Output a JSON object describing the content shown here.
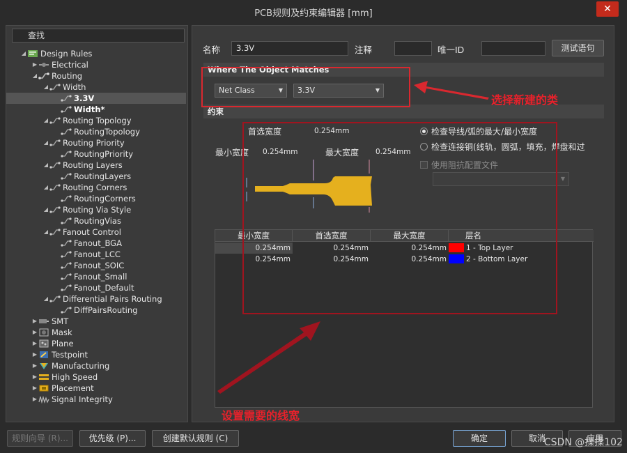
{
  "window": {
    "title": "PCB规则及约束编辑器 [mm]",
    "close_glyph": "✕"
  },
  "search": {
    "placeholder": "查找"
  },
  "tree": [
    {
      "label": "Design Rules",
      "depth": 0,
      "expanded": true,
      "icon": "rules-icon"
    },
    {
      "label": "Electrical",
      "depth": 1,
      "expanded": false,
      "icon": "electrical-icon"
    },
    {
      "label": "Routing",
      "depth": 1,
      "expanded": true,
      "icon": "routing-icon"
    },
    {
      "label": "Width",
      "depth": 2,
      "expanded": true,
      "icon": "rule-icon"
    },
    {
      "label": "3.3V",
      "depth": 3,
      "selected": true,
      "bold": true,
      "icon": "rule-icon"
    },
    {
      "label": "Width*",
      "depth": 3,
      "bold": true,
      "icon": "rule-icon"
    },
    {
      "label": "Routing Topology",
      "depth": 2,
      "expanded": true,
      "icon": "rule-icon"
    },
    {
      "label": "RoutingTopology",
      "depth": 3,
      "icon": "rule-icon"
    },
    {
      "label": "Routing Priority",
      "depth": 2,
      "expanded": true,
      "icon": "rule-icon"
    },
    {
      "label": "RoutingPriority",
      "depth": 3,
      "icon": "rule-icon"
    },
    {
      "label": "Routing Layers",
      "depth": 2,
      "expanded": true,
      "icon": "rule-icon"
    },
    {
      "label": "RoutingLayers",
      "depth": 3,
      "icon": "rule-icon"
    },
    {
      "label": "Routing Corners",
      "depth": 2,
      "expanded": true,
      "icon": "rule-icon"
    },
    {
      "label": "RoutingCorners",
      "depth": 3,
      "icon": "rule-icon"
    },
    {
      "label": "Routing Via Style",
      "depth": 2,
      "expanded": true,
      "icon": "rule-icon"
    },
    {
      "label": "RoutingVias",
      "depth": 3,
      "icon": "rule-icon"
    },
    {
      "label": "Fanout Control",
      "depth": 2,
      "expanded": true,
      "icon": "rule-icon"
    },
    {
      "label": "Fanout_BGA",
      "depth": 3,
      "icon": "rule-icon"
    },
    {
      "label": "Fanout_LCC",
      "depth": 3,
      "icon": "rule-icon"
    },
    {
      "label": "Fanout_SOIC",
      "depth": 3,
      "icon": "rule-icon"
    },
    {
      "label": "Fanout_Small",
      "depth": 3,
      "icon": "rule-icon"
    },
    {
      "label": "Fanout_Default",
      "depth": 3,
      "icon": "rule-icon"
    },
    {
      "label": "Differential Pairs Routing",
      "depth": 2,
      "expanded": true,
      "icon": "rule-icon"
    },
    {
      "label": "DiffPairsRouting",
      "depth": 3,
      "icon": "rule-icon"
    },
    {
      "label": "SMT",
      "depth": 1,
      "expanded": false,
      "icon": "smt-icon"
    },
    {
      "label": "Mask",
      "depth": 1,
      "expanded": false,
      "icon": "mask-icon"
    },
    {
      "label": "Plane",
      "depth": 1,
      "expanded": false,
      "icon": "plane-icon"
    },
    {
      "label": "Testpoint",
      "depth": 1,
      "expanded": false,
      "icon": "testpoint-icon"
    },
    {
      "label": "Manufacturing",
      "depth": 1,
      "expanded": false,
      "icon": "manufacturing-icon"
    },
    {
      "label": "High Speed",
      "depth": 1,
      "expanded": false,
      "icon": "highspeed-icon"
    },
    {
      "label": "Placement",
      "depth": 1,
      "expanded": false,
      "icon": "placement-icon"
    },
    {
      "label": "Signal Integrity",
      "depth": 1,
      "expanded": false,
      "icon": "signal-icon"
    }
  ],
  "header": {
    "name_label": "名称",
    "name_value": "3.3V",
    "comment_label": "注释",
    "comment_value": "",
    "uid_label": "唯一ID",
    "uid_value": "",
    "test_button": "测试语句"
  },
  "where": {
    "title": "Where The Object Matches",
    "type_value": "Net Class",
    "class_value": "3.3V"
  },
  "constraints": {
    "title": "约束",
    "preferred_label": "首选宽度",
    "preferred_value": "0.254mm",
    "min_label": "最小宽度",
    "min_value": "0.254mm",
    "max_label": "最大宽度",
    "max_value": "0.254mm",
    "radio1": "检查导线/弧的最大/最小宽度",
    "radio2": "检查连接铜(线轨，圆弧，填充，焊盘和过",
    "impedance_label": "使用阻抗配置文件"
  },
  "table": {
    "headers": [
      "最小宽度",
      "首选宽度",
      "最大宽度",
      "层名"
    ],
    "rows": [
      {
        "min": "0.254mm",
        "pref": "0.254mm",
        "max": "0.254mm",
        "color": "#ff0000",
        "layer": "1 - Top Layer"
      },
      {
        "min": "0.254mm",
        "pref": "0.254mm",
        "max": "0.254mm",
        "color": "#0000ff",
        "layer": "2 - Bottom Layer"
      }
    ]
  },
  "annotations": {
    "class_note": "选择新建的类",
    "width_note": "设置需要的线宽"
  },
  "buttons": {
    "wizard": "规则向导 (R)...",
    "priority": "优先级 (P)...",
    "default_rules": "创建默认规则 (C)",
    "ok": "确定",
    "cancel": "取消",
    "apply": "应用"
  },
  "watermark": "CSDN @揉揉102",
  "colors": {
    "annotation_red": "#e8212b",
    "trace_yellow": "#e5b01e"
  }
}
